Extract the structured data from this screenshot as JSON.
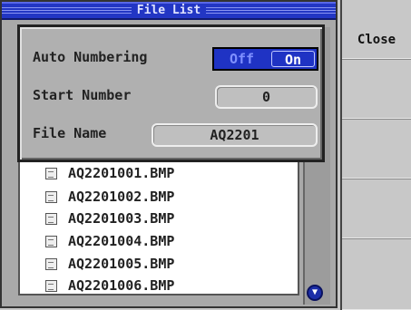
{
  "window": {
    "title": "File List"
  },
  "files": [
    "AQ2201001.BMP",
    "AQ2201002.BMP",
    "AQ2201003.BMP",
    "AQ2201004.BMP",
    "AQ2201005.BMP",
    "AQ2201006.BMP"
  ],
  "dialog": {
    "auto_numbering_label": "Auto Numbering",
    "toggle_off": "Off",
    "toggle_on": "On",
    "toggle_selected": "On",
    "start_number_label": "Start Number",
    "start_number_value": "0",
    "file_name_label": "File Name",
    "file_name_value": "AQ2201"
  },
  "side_menu": {
    "close_label": "Close"
  },
  "colors": {
    "accent": "#1f33c4",
    "panel": "#b0b0b0",
    "list_bg": "#ffffff"
  },
  "icons": {
    "file": "file-icon",
    "scroll": "scroll-down-arrow-icon"
  }
}
